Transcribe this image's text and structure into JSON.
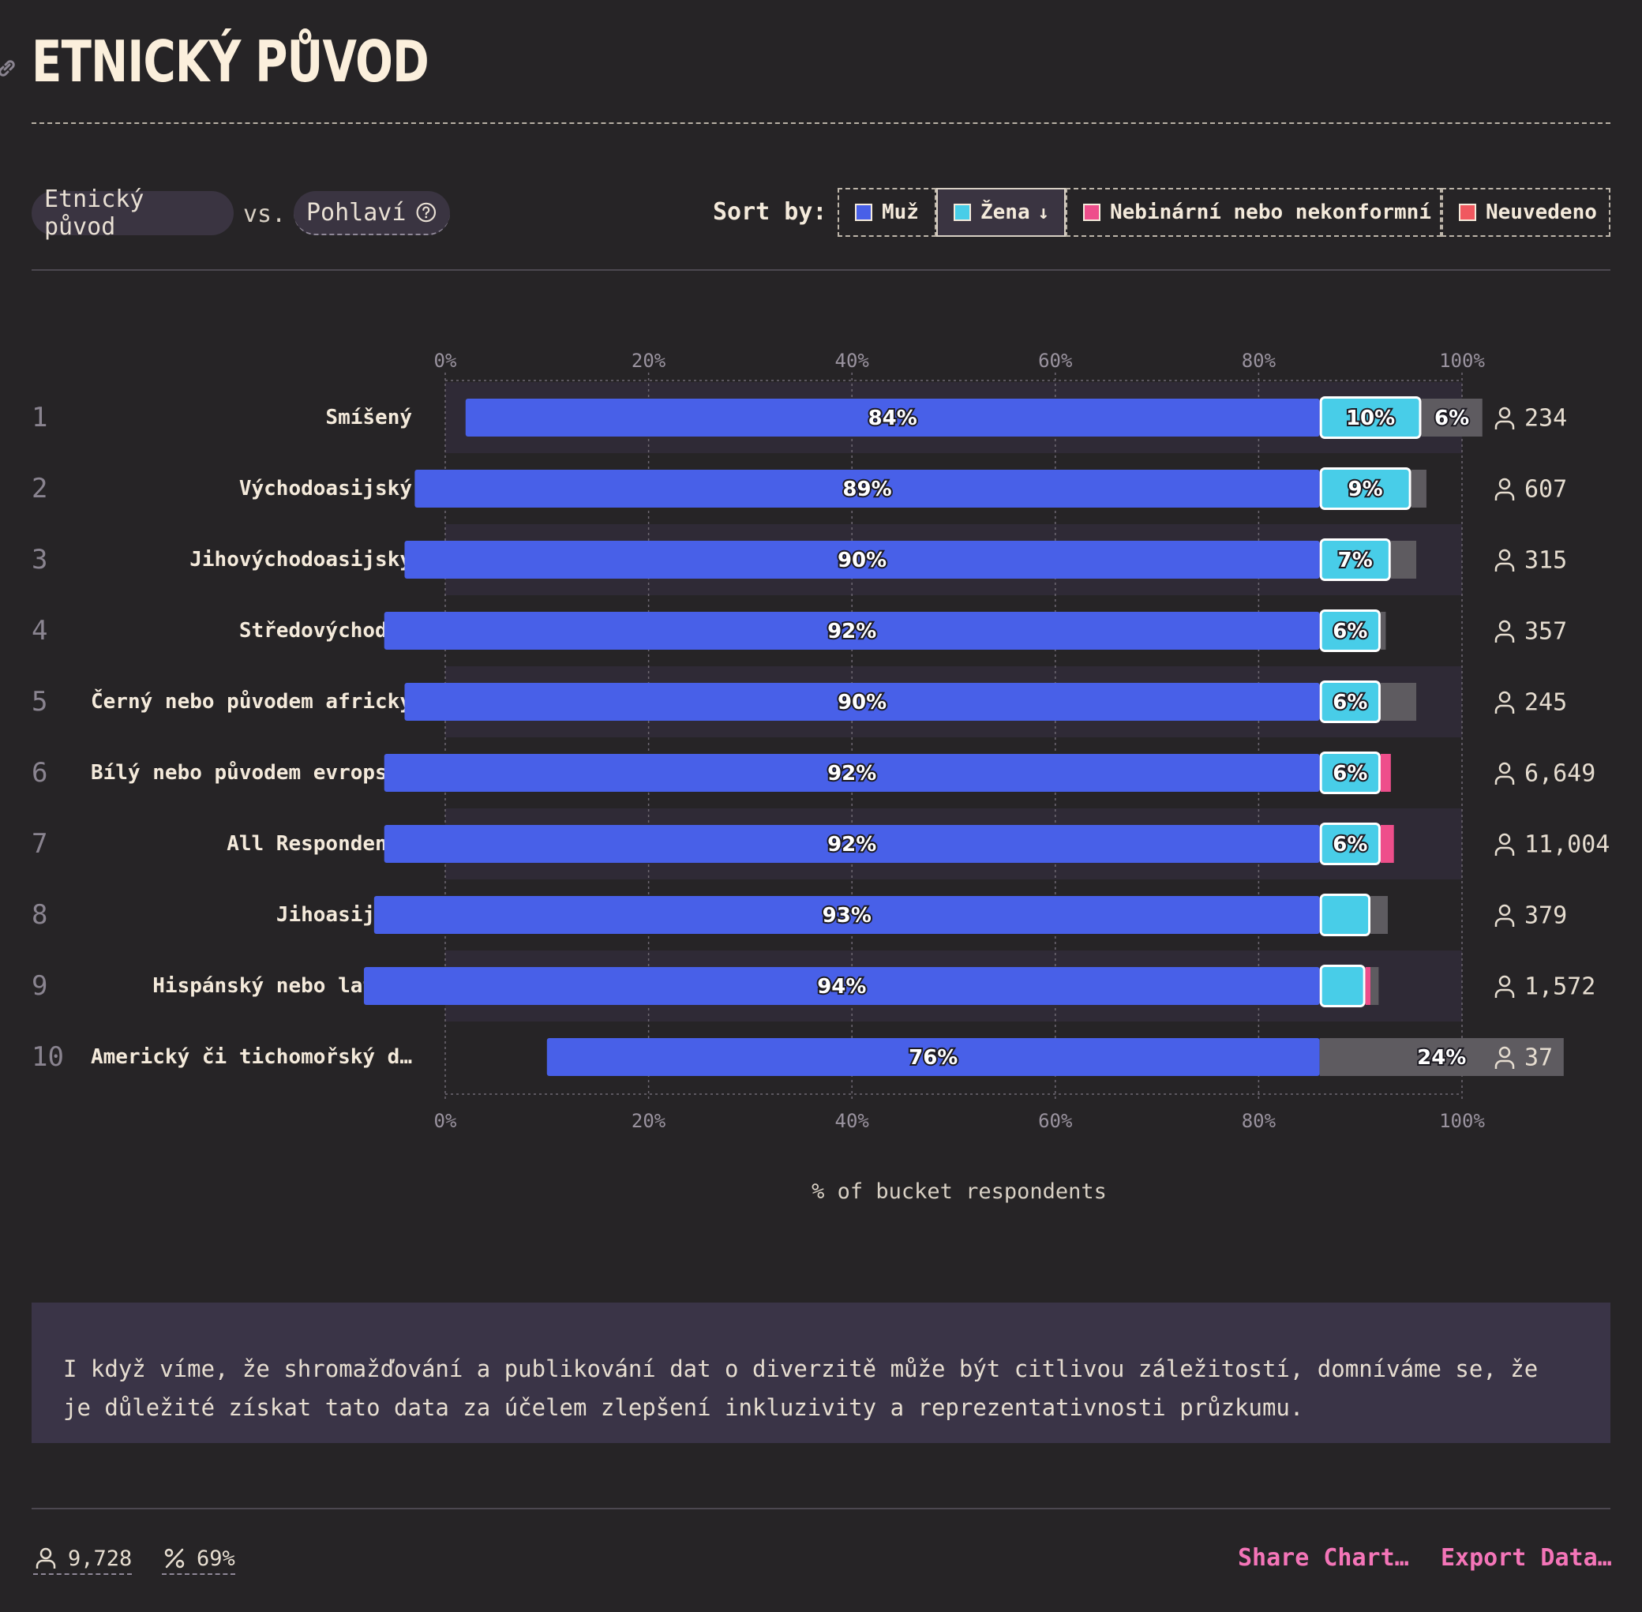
{
  "header": {
    "title": "ETNICKÝ PŮVOD"
  },
  "controls": {
    "field1": "Etnický původ",
    "vs": "vs.",
    "field2": "Pohlaví",
    "sort_label": "Sort by:",
    "sort_options": [
      {
        "label": "Muž",
        "color": "#4860e8"
      },
      {
        "label": "Žena",
        "color": "#48cde8",
        "active": true,
        "arrow": "↓"
      },
      {
        "label": "Nebinární nebo nekonformní",
        "color": "#ee4e8b"
      },
      {
        "label": "Neuvedeno",
        "color": "#f0585f"
      }
    ]
  },
  "chart_data": {
    "type": "bar",
    "orientation": "horizontal-stacked",
    "xlabel": "% of bucket respondents",
    "xlim": [
      0,
      100
    ],
    "x_ticks": [
      "0%",
      "20%",
      "40%",
      "60%",
      "80%",
      "100%"
    ],
    "grid": true,
    "colors": {
      "muz": "#4860e8",
      "zena": "#48cde8",
      "nebinarni": "#ee4e8b",
      "neuvedeno": "#5e5b60"
    },
    "rows": [
      {
        "rank": "1",
        "label": "Smíšený",
        "count": "234",
        "muz": 84,
        "zena": 10,
        "nebinarni": 0,
        "neuvedeno": 6,
        "muz_label": "84%",
        "zena_label": "10%",
        "rest_label": "6%"
      },
      {
        "rank": "2",
        "label": "Východoasijský",
        "count": "607",
        "muz": 89,
        "zena": 9,
        "nebinarni": 0,
        "neuvedeno": 1.5,
        "muz_label": "89%",
        "zena_label": "9%",
        "rest_label": ""
      },
      {
        "rank": "3",
        "label": "Jihovýchodoasijský",
        "count": "315",
        "muz": 90,
        "zena": 7,
        "nebinarni": 0,
        "neuvedeno": 2.5,
        "muz_label": "90%",
        "zena_label": "7%",
        "rest_label": ""
      },
      {
        "rank": "4",
        "label": "Středovýchodní",
        "count": "357",
        "muz": 92,
        "zena": 6,
        "nebinarni": 0,
        "neuvedeno": 0.5,
        "muz_label": "92%",
        "zena_label": "6%",
        "rest_label": ""
      },
      {
        "rank": "5",
        "label": "Černý nebo původem africký",
        "count": "245",
        "muz": 90,
        "zena": 6,
        "nebinarni": 0,
        "neuvedeno": 3.5,
        "muz_label": "90%",
        "zena_label": "6%",
        "rest_label": ""
      },
      {
        "rank": "6",
        "label": "Bílý nebo původem evropský",
        "count": "6,649",
        "muz": 92,
        "zena": 6,
        "nebinarni": 1,
        "neuvedeno": 0,
        "muz_label": "92%",
        "zena_label": "6%",
        "rest_label": ""
      },
      {
        "rank": "7",
        "label": "All Respondents",
        "count": "11,004",
        "muz": 92,
        "zena": 6,
        "nebinarni": 1.3,
        "neuvedeno": 0,
        "muz_label": "92%",
        "zena_label": "6%",
        "rest_label": ""
      },
      {
        "rank": "8",
        "label": "Jihoasijský",
        "count": "379",
        "muz": 93,
        "zena": 5,
        "nebinarni": 0,
        "neuvedeno": 1.7,
        "muz_label": "93%",
        "zena_label": "",
        "rest_label": ""
      },
      {
        "rank": "9",
        "label": "Hispánský nebo latino",
        "count": "1,572",
        "muz": 94,
        "zena": 4.5,
        "nebinarni": 0.5,
        "neuvedeno": 0.8,
        "muz_label": "94%",
        "zena_label": "",
        "rest_label": ""
      },
      {
        "rank": "10",
        "label": "Americký či tichomořský d…",
        "count": "37",
        "muz": 76,
        "zena": 0,
        "nebinarni": 0,
        "neuvedeno": 24,
        "muz_label": "76%",
        "zena_label": "",
        "rest_label": "24%"
      }
    ]
  },
  "summary": {
    "text": "I když víme, že shromažďování a publikování dat o diverzitě může být citlivou záležitostí, domníváme se, že je důležité získat tato data za účelem zlepšení inkluzivity a reprezentativnosti průzkumu."
  },
  "footer": {
    "respondents": "9,728",
    "percent": "69%",
    "share": "Share Chart…",
    "export": "Export Data…"
  }
}
